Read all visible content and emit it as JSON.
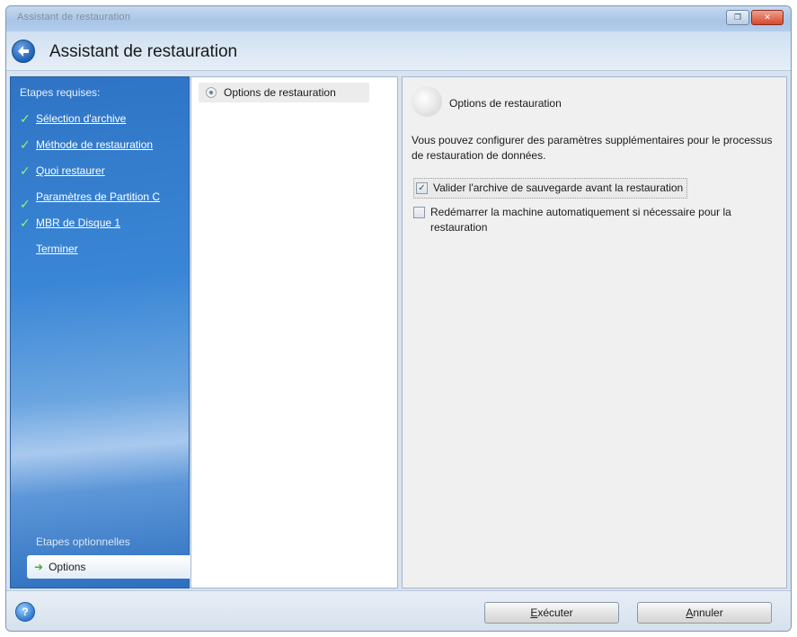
{
  "window": {
    "title": "Assistant de restauration",
    "header_title": "Assistant de restauration"
  },
  "sidebar": {
    "required_heading": "Etapes requises:",
    "steps": [
      {
        "label": "Sélection d'archive",
        "done": true
      },
      {
        "label": "Méthode de restauration",
        "done": true
      },
      {
        "label": "Quoi restaurer",
        "done": true
      },
      {
        "label": "Paramètres de Partition C",
        "done": true
      },
      {
        "label": "MBR de Disque 1",
        "done": true
      },
      {
        "label": "Terminer",
        "done": false
      }
    ],
    "optional_heading": "Etapes optionnelles",
    "optional_item": "Options"
  },
  "tree": {
    "item": "Options de restauration"
  },
  "panel": {
    "title": "Options de restauration",
    "description": "Vous pouvez configurer des paramètres supplémentaires pour le processus de restauration de données.",
    "options": [
      {
        "label": "Valider l'archive de sauvegarde avant la restauration",
        "checked": true
      },
      {
        "label": "Redémarrer la machine automatiquement si nécessaire pour la restauration",
        "checked": false
      }
    ]
  },
  "footer": {
    "execute_label": "Exécuter",
    "cancel_label": "Annuler"
  },
  "colors": {
    "sidebar_blue": "#3a86d6",
    "check_green": "#9df07a",
    "accent": "#2f78cf"
  },
  "icons": {
    "back": "back-arrow-icon",
    "help": "help-icon",
    "check": "check-icon",
    "options_arrow": "arrow-right-icon"
  }
}
